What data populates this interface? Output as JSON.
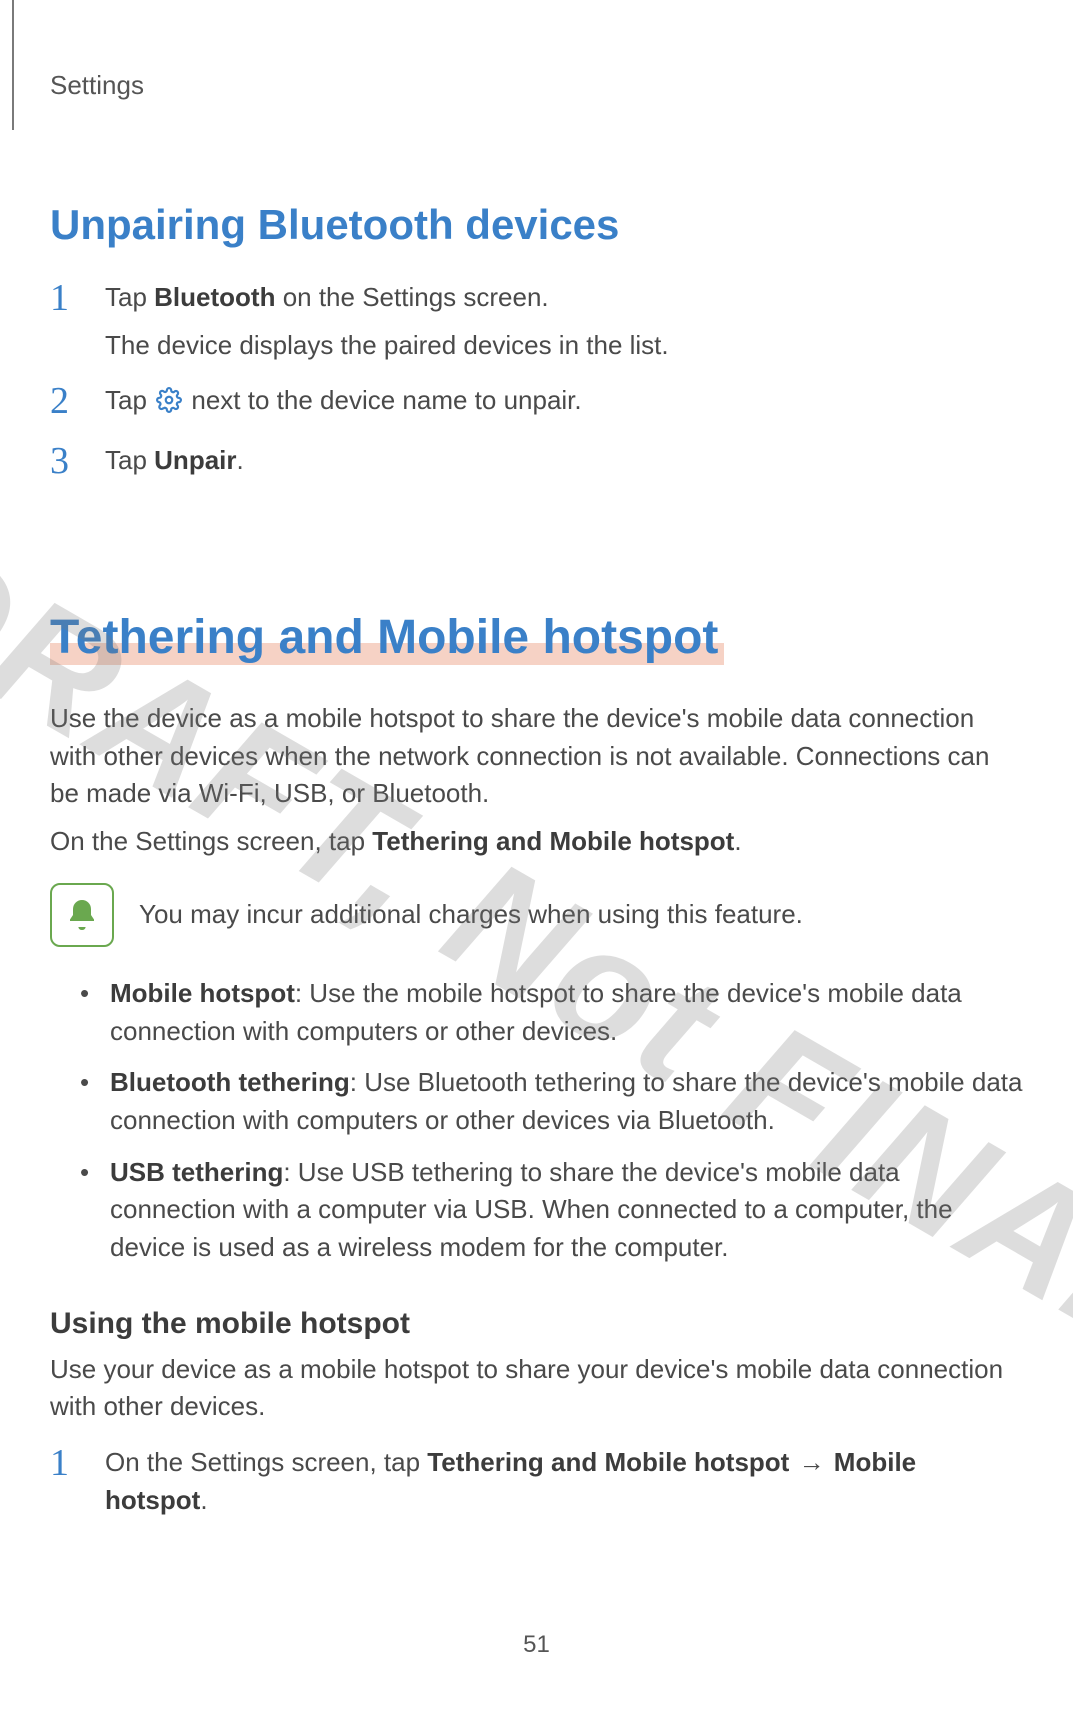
{
  "header": {
    "category": "Settings"
  },
  "section_unpair": {
    "heading": "Unpairing Bluetooth devices",
    "steps": [
      {
        "num": "1",
        "line_pre": "Tap ",
        "bold": "Bluetooth",
        "line_post": " on the Settings screen.",
        "sub": "The device displays the paired devices in the list."
      },
      {
        "num": "2",
        "line_pre": "Tap ",
        "icon": "gear",
        "line_post": " next to the device name to unpair."
      },
      {
        "num": "3",
        "line_pre": "Tap ",
        "bold": "Unpair",
        "line_post": "."
      }
    ]
  },
  "section_tether": {
    "heading": "Tethering and Mobile hotspot",
    "intro": "Use the device as a mobile hotspot to share the device's mobile data connection with other devices when the network connection is not available. Connections can be made via Wi-Fi, USB, or Bluetooth.",
    "on_settings_pre": "On the Settings screen, tap ",
    "on_settings_bold": "Tethering and Mobile hotspot",
    "on_settings_post": ".",
    "note": "You may incur additional charges when using this feature.",
    "bullets": [
      {
        "bold": "Mobile hotspot",
        "text": ": Use the mobile hotspot to share the device's mobile data connection with computers or other devices."
      },
      {
        "bold": "Bluetooth tethering",
        "text": ": Use Bluetooth tethering to share the device's mobile data connection with computers or other devices via Bluetooth."
      },
      {
        "bold": "USB tethering",
        "text": ": Use USB tethering to share the device's mobile data connection with a computer via USB. When connected to a computer, the device is used as a wireless modem for the computer."
      }
    ],
    "sub_heading": "Using the mobile hotspot",
    "sub_intro": "Use your device as a mobile hotspot to share your device's mobile data connection with other devices.",
    "step1": {
      "num": "1",
      "pre": "On the Settings screen, tap ",
      "bold1": "Tethering and Mobile hotspot",
      "arrow": " → ",
      "bold2": "Mobile hotspot",
      "post": "."
    }
  },
  "watermark": "DRAFT, Not FINAL",
  "page_number": "51"
}
